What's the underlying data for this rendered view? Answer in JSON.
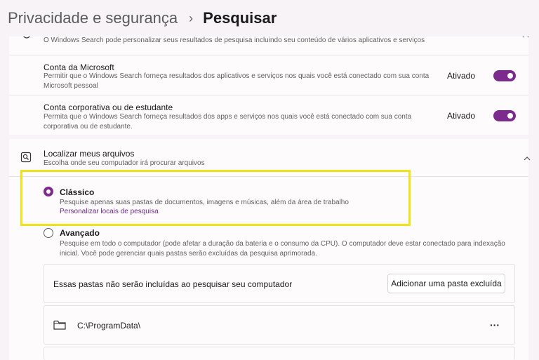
{
  "header": {
    "parent": "Privacidade e segurança",
    "separator": "›",
    "current": "Pesquisar"
  },
  "top_card": {
    "description": "O Windows Search pode personalizar seus resultados de pesquisa incluindo seu conteúdo de vários aplicativos e serviços"
  },
  "microsoft_account": {
    "title": "Conta da Microsoft",
    "desc_line1": "Permitir que o Windows Search forneça resultados dos aplicativos e serviços nos quais você está conectado com sua conta",
    "desc_line2": "Microsoft pessoal",
    "state": "Ativado"
  },
  "work_account": {
    "title": "Conta corporativa ou de estudante",
    "desc_line1": "Permita que o Windows Search forneça resultados dos apps e serviços nos quais você está conectado com sua conta",
    "desc_line2": "corporativa ou de estudante.",
    "state": "Ativado"
  },
  "find_files": {
    "title": "Localizar meus arquivos",
    "subtitle": "Escolha onde seu computador irá procurar arquivos"
  },
  "classic": {
    "label": "Clássico",
    "desc": "Pesquise apenas suas pastas de documentos, imagens e músicas, além da área de trabalho",
    "link": "Personalizar locais de pesquisa"
  },
  "advanced": {
    "label": "Avançado",
    "desc_line1": "Pesquise em todo o computador (pode afetar a duração da bateria e o consumo da CPU). O computador deve estar conectado para indexação",
    "desc_line2": "inicial. Você pode gerenciar quais pastas serão excluídas da pesquisa aprimorada."
  },
  "excluded": {
    "text": "Essas pastas não serão incluídas ao pesquisar seu computador",
    "button": "Adicionar uma pasta excluída",
    "folder": "C:\\ProgramData\\",
    "more": "···"
  },
  "colors": {
    "accent": "#7d2a8e",
    "highlight": "#f2e21a"
  },
  "icons": [
    "search-settings-icon",
    "folder-icon",
    "more-icon",
    "chevron-up-icon"
  ]
}
